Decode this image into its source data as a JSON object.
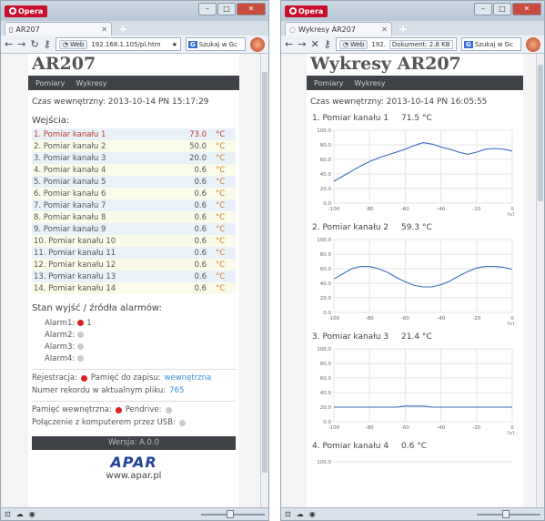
{
  "left": {
    "tab_title": "AR207",
    "url": "192.168.1.105/pl.htm",
    "web_label": "Web",
    "search_placeholder": "Szukaj w Gc",
    "page_title": "AR207",
    "menu": [
      "Pomiary",
      "Wykresy"
    ],
    "time_text": "Czas wewnętrzny: 2013-10-14 PN 15:17:29",
    "inputs_title": "Wejścia:",
    "unit": "°C",
    "channels": [
      {
        "name": "1. Pomiar kanału 1",
        "value": "73.0"
      },
      {
        "name": "2. Pomiar kanału 2",
        "value": "50.0"
      },
      {
        "name": "3. Pomiar kanału 3",
        "value": "20.0"
      },
      {
        "name": "4. Pomiar kanału 4",
        "value": "0.6"
      },
      {
        "name": "5. Pomiar kanału 5",
        "value": "0.6"
      },
      {
        "name": "6. Pomiar kanału 6",
        "value": "0.6"
      },
      {
        "name": "7. Pomiar kanału 7",
        "value": "0.6"
      },
      {
        "name": "8. Pomiar kanału 8",
        "value": "0.6"
      },
      {
        "name": "9. Pomiar kanału 9",
        "value": "0.6"
      },
      {
        "name": "10. Pomiar kanału 10",
        "value": "0.6"
      },
      {
        "name": "11. Pomiar kanału 11",
        "value": "0.6"
      },
      {
        "name": "12. Pomiar kanału 12",
        "value": "0.6"
      },
      {
        "name": "13. Pomiar kanału 13",
        "value": "0.6"
      },
      {
        "name": "14. Pomiar kanału 14",
        "value": "0.6"
      }
    ],
    "alarms_title": "Stan wyjść / źródła alarmów:",
    "alarms": [
      {
        "label": "Alarm1:",
        "state": "red",
        "extra": "1"
      },
      {
        "label": "Alarm2:",
        "state": "gray",
        "extra": ""
      },
      {
        "label": "Alarm3:",
        "state": "gray",
        "extra": ""
      },
      {
        "label": "Alarm4:",
        "state": "gray",
        "extra": ""
      }
    ],
    "registration_label": "Rejestracja:",
    "memory_label": "Pamięć do zapisu:",
    "memory_value": "wewnętrzna",
    "record_label": "Numer rekordu w aktualnym pliku:",
    "record_value": "765",
    "internal_memory_label": "Pamięć wewnętrzna:",
    "pendrive_label": "Pendrive:",
    "usb_label": "Połączenie z komputerem przez USB:",
    "version": "Wersja: A.0.0",
    "logo_text": "APAR",
    "site": "www.apar.pl"
  },
  "right": {
    "tab_title": "Wykresy AR207",
    "url": "192.",
    "download_text": "Dokument: 2.8 KB",
    "web_label": "Web",
    "search_placeholder": "Szukaj w Gc",
    "page_title": "Wykresy AR207",
    "menu": [
      "Pomiary",
      "Wykresy"
    ],
    "time_text": "Czas wewnętrzny: 2013-10-14 PN 16:05:55",
    "charts": [
      {
        "title": "1. Pomiar kanału 1",
        "value": "71.5 °C"
      },
      {
        "title": "2. Pomiar kanału 2",
        "value": "59.3 °C"
      },
      {
        "title": "3. Pomiar kanału 3",
        "value": "21.4 °C"
      },
      {
        "title": "4. Pomiar kanału 4",
        "value": "0.6 °C"
      }
    ]
  },
  "chart_data": [
    {
      "type": "line",
      "title": "1. Pomiar kanału 1",
      "xlabel": "[s]",
      "ylim": [
        0,
        100
      ],
      "xlim": [
        -100,
        0
      ],
      "yticks": [
        "0.0",
        "20.0",
        "40.0",
        "60.0",
        "80.0",
        "100.0"
      ],
      "xticks": [
        "-100",
        "-80",
        "-60",
        "-40",
        "-20",
        "0"
      ],
      "x": [
        -100,
        -95,
        -90,
        -85,
        -80,
        -75,
        -70,
        -65,
        -60,
        -55,
        -50,
        -45,
        -40,
        -35,
        -30,
        -25,
        -20,
        -15,
        -10,
        -5,
        0
      ],
      "y": [
        30,
        37,
        44,
        51,
        57,
        62,
        66,
        70,
        74,
        79,
        83,
        81,
        77,
        74,
        70,
        67,
        70,
        74,
        75,
        74,
        71.5
      ]
    },
    {
      "type": "line",
      "title": "2. Pomiar kanału 2",
      "xlabel": "[s]",
      "ylim": [
        0,
        100
      ],
      "xlim": [
        -100,
        0
      ],
      "yticks": [
        "0.0",
        "20.0",
        "40.0",
        "60.0",
        "80.0",
        "100.0"
      ],
      "xticks": [
        "-100",
        "-80",
        "-60",
        "-40",
        "-20",
        "0"
      ],
      "x": [
        -100,
        -95,
        -90,
        -85,
        -80,
        -75,
        -70,
        -65,
        -60,
        -55,
        -50,
        -45,
        -40,
        -35,
        -30,
        -25,
        -20,
        -15,
        -10,
        -5,
        0
      ],
      "y": [
        46,
        53,
        60,
        63,
        63,
        60,
        55,
        48,
        42,
        37,
        35,
        35,
        38,
        43,
        50,
        56,
        61,
        63,
        63,
        62,
        59.3
      ]
    },
    {
      "type": "line",
      "title": "3. Pomiar kanału 3",
      "xlabel": "[s]",
      "ylim": [
        0,
        100
      ],
      "xlim": [
        -100,
        0
      ],
      "yticks": [
        "0.0",
        "20.0",
        "40.0",
        "60.0",
        "80.0",
        "100.0"
      ],
      "xticks": [
        "-100",
        "-80",
        "-60",
        "-40",
        "-20",
        "0"
      ],
      "x": [
        -100,
        -80,
        -65,
        -60,
        -50,
        -45,
        -40,
        -20,
        0
      ],
      "y": [
        20,
        20,
        20,
        21.5,
        21.5,
        20,
        20,
        20,
        20
      ]
    },
    {
      "type": "line",
      "title": "4. Pomiar kanału 4",
      "ylim": [
        0,
        100
      ],
      "yticks": [
        "100.0"
      ]
    }
  ],
  "colors": {
    "line": "#3a6bb8",
    "accent_red": "#d92121",
    "unit": "#c57d2a",
    "link": "#3b8ed6",
    "menu_bg": "#3f4246"
  }
}
